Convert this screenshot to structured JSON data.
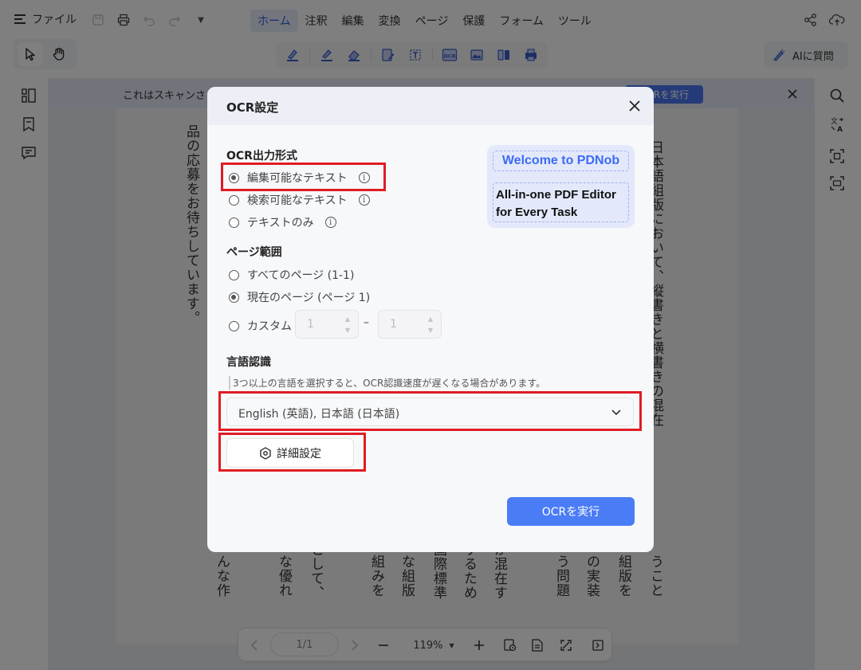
{
  "topbar": {
    "file_label": "ファイル",
    "tabs": [
      {
        "label": "ホーム",
        "active": true
      },
      {
        "label": "注釈",
        "active": false
      },
      {
        "label": "編集",
        "active": false
      },
      {
        "label": "変換",
        "active": false
      },
      {
        "label": "ページ",
        "active": false
      },
      {
        "label": "保護",
        "active": false
      },
      {
        "label": "フォーム",
        "active": false
      },
      {
        "label": "ツール",
        "active": false
      }
    ],
    "ask_ai_label": "AIに質問"
  },
  "banner": {
    "text": "これはスキャンさ",
    "button_label": "OCRを実行"
  },
  "document": {
    "columns": [
      "品の応募をお待ちしています。",
      "んな作",
      "な優れ",
      "として、",
      "組みを",
      "な組版",
      "国際標準",
      "するため",
      "が混在す",
      "う問題",
      "の実装",
      "組版を",
      "うこと",
      "日本語組版において、縦書きと横書きの混在"
    ]
  },
  "bottom": {
    "page_indicator": "1/1",
    "zoom": "119%"
  },
  "dialog": {
    "title": "OCR設定",
    "output_section": "OCR出力形式",
    "output_options": [
      {
        "label": "編集可能なテキスト",
        "checked": true
      },
      {
        "label": "検索可能なテキスト",
        "checked": false
      },
      {
        "label": "テキストのみ",
        "checked": false
      }
    ],
    "page_section": "ページ範囲",
    "page_options": [
      {
        "label": "すべてのページ (1-1)",
        "checked": false
      },
      {
        "label": "現在のページ (ページ 1)",
        "checked": true
      },
      {
        "label": "カスタム",
        "checked": false
      }
    ],
    "custom_from": "1",
    "custom_to": "1",
    "custom_separator": "–",
    "lang_section": "言語認識",
    "lang_note": "3つ以上の言語を選択すると、OCR認識速度が遅くなる場合があります。",
    "lang_value": "English (英語), 日本語 (日本語)",
    "advanced_label": "詳細設定",
    "run_label": "OCRを実行",
    "promo_line1": "Welcome to PDNob",
    "promo_line2": "All-in-one PDF Editor",
    "promo_line3": "for Every Task"
  },
  "colors": {
    "accent": "#4a7cf6",
    "annotation": "#e01c24",
    "overlay": "rgba(0,0,0,0.5)"
  }
}
